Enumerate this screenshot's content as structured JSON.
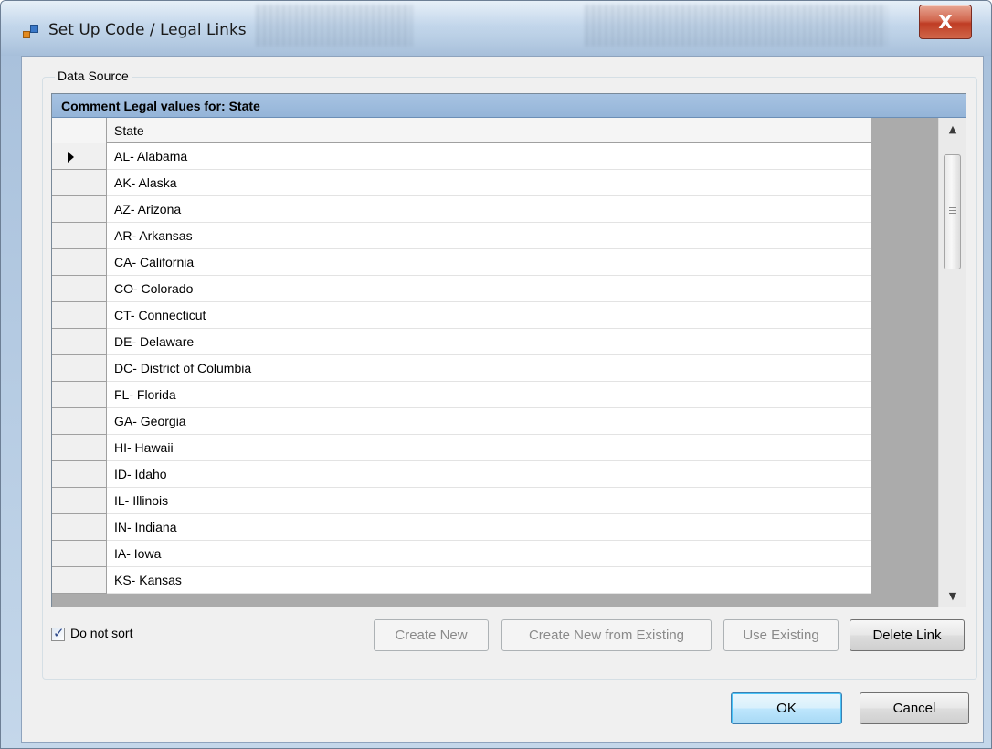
{
  "window": {
    "title": "Set Up Code / Legal Links",
    "close_glyph": "X"
  },
  "groupbox": {
    "label": "Data Source"
  },
  "grid": {
    "caption": "Comment Legal values for: State",
    "column_header": "State",
    "selected_row_index": 0,
    "rows": [
      "AL- Alabama",
      "AK- Alaska",
      "AZ- Arizona",
      "AR- Arkansas",
      "CA- California",
      "CO- Colorado",
      "CT- Connecticut",
      "DE- Delaware",
      "DC- District of Columbia",
      "FL- Florida",
      "GA- Georgia",
      "HI- Hawaii",
      "ID- Idaho",
      "IL- Illinois",
      "IN- Indiana",
      "IA- Iowa",
      "KS- Kansas"
    ]
  },
  "scrollbar": {
    "up_glyph": "▲",
    "down_glyph": "▼"
  },
  "options": {
    "do_not_sort_label": "Do not sort",
    "do_not_sort_checked": true,
    "check_glyph": "✓"
  },
  "actions": {
    "create_new": "Create New",
    "create_new_from_existing": "Create New from Existing",
    "use_existing": "Use Existing",
    "delete_link": "Delete Link"
  },
  "dialog_buttons": {
    "ok": "OK",
    "cancel": "Cancel"
  },
  "colors": {
    "caption_bar": "#94b4d8",
    "default_button_border": "#3c7fb1",
    "close_button": "#c9452a"
  }
}
